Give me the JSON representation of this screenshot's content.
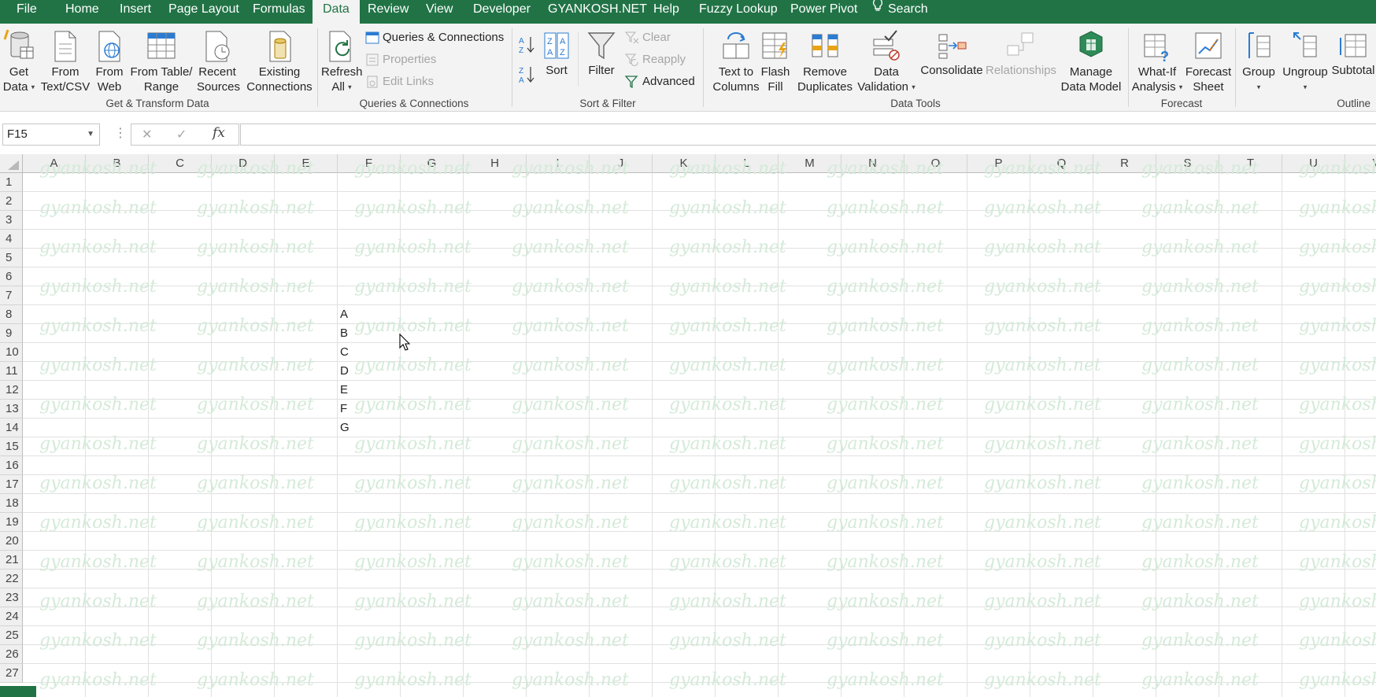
{
  "tabs": [
    "File",
    "Home",
    "Insert",
    "Page Layout",
    "Formulas",
    "Data",
    "Review",
    "View",
    "Developer",
    "GYANKOSH.NET",
    "Help",
    "Fuzzy Lookup",
    "Power Pivot",
    "Search"
  ],
  "active_tab": "Data",
  "ribbon": {
    "get_transform": {
      "get_data": [
        "Get",
        "Data"
      ],
      "from_text_csv": [
        "From",
        "Text/CSV"
      ],
      "from_web": [
        "From",
        "Web"
      ],
      "from_table_range": [
        "From Table/",
        "Range"
      ],
      "recent_sources": [
        "Recent",
        "Sources"
      ],
      "existing_connections": [
        "Existing",
        "Connections"
      ],
      "group_label": "Get & Transform Data"
    },
    "queries": {
      "refresh_all": [
        "Refresh",
        "All"
      ],
      "queries_connections": "Queries & Connections",
      "properties": "Properties",
      "edit_links": "Edit Links",
      "group_label": "Queries & Connections"
    },
    "sort_filter": {
      "sort": "Sort",
      "filter": "Filter",
      "clear": "Clear",
      "reapply": "Reapply",
      "advanced": "Advanced",
      "group_label": "Sort & Filter"
    },
    "data_tools": {
      "text_to_columns": [
        "Text to",
        "Columns"
      ],
      "flash_fill": [
        "Flash",
        "Fill"
      ],
      "remove_duplicates": [
        "Remove",
        "Duplicates"
      ],
      "data_validation": [
        "Data",
        "Validation"
      ],
      "consolidate": "Consolidate",
      "relationships": "Relationships",
      "manage_data_model": [
        "Manage",
        "Data Model"
      ],
      "group_label": "Data Tools"
    },
    "forecast": {
      "what_if": [
        "What-If",
        "Analysis"
      ],
      "forecast_sheet": [
        "Forecast",
        "Sheet"
      ],
      "group_label": "Forecast"
    },
    "outline": {
      "group": "Group",
      "ungroup": "Ungroup",
      "subtotal": "Subtotal",
      "group_label": "Outline"
    }
  },
  "formula_bar": {
    "name_box": "F15",
    "cancel_symbol": "✕",
    "enter_symbol": "✓",
    "fx_symbol": "fx",
    "formula": ""
  },
  "sheet": {
    "columns": [
      "A",
      "B",
      "C",
      "D",
      "E",
      "F",
      "G",
      "H",
      "I",
      "J",
      "K",
      "L",
      "M",
      "N",
      "O",
      "P",
      "Q",
      "R",
      "S",
      "T",
      "U",
      "V"
    ],
    "rows": [
      "1",
      "2",
      "3",
      "4",
      "5",
      "6",
      "7",
      "8",
      "9",
      "10",
      "11",
      "12",
      "13",
      "14",
      "15",
      "16",
      "17",
      "18",
      "19",
      "20",
      "21",
      "22",
      "23",
      "24",
      "25",
      "26",
      "27"
    ],
    "cells": [
      {
        "ref": "F8",
        "value": "A"
      },
      {
        "ref": "F9",
        "value": "B"
      },
      {
        "ref": "F10",
        "value": "C"
      },
      {
        "ref": "F11",
        "value": "D"
      },
      {
        "ref": "F12",
        "value": "E"
      },
      {
        "ref": "F13",
        "value": "F"
      },
      {
        "ref": "F14",
        "value": "G"
      }
    ],
    "watermark": "gyankosh.net",
    "selected_cell": "F15"
  },
  "colors": {
    "excel_green": "#217346",
    "ribbon_bg": "#f3f3f3",
    "watermark": "#d4ead8"
  }
}
